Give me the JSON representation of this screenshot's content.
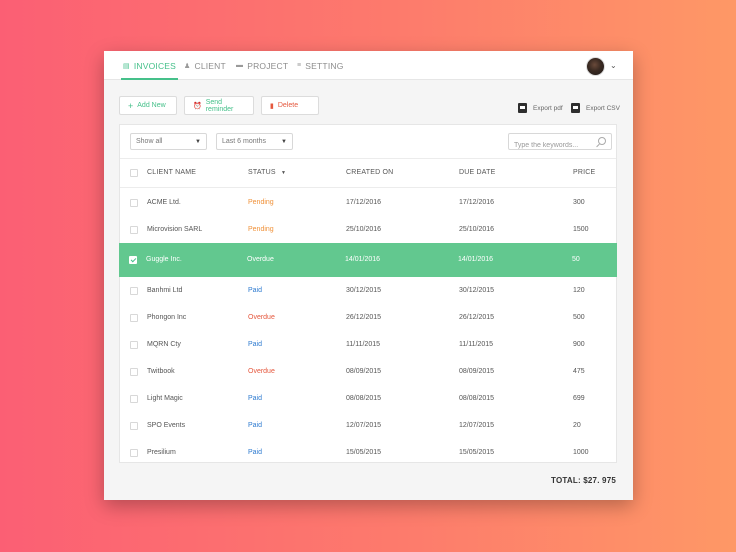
{
  "nav": {
    "tabs": [
      {
        "label": "INVOICES",
        "icon": "document-icon",
        "glyph": "▤"
      },
      {
        "label": "CLIENT",
        "icon": "user-icon",
        "glyph": "♟"
      },
      {
        "label": "PROJECT",
        "icon": "folder-icon",
        "glyph": "▬"
      },
      {
        "label": "SETTING",
        "icon": "sliders-icon",
        "glyph": "≡"
      }
    ],
    "active_tab": "INVOICES",
    "avatar_chevron": "⌄"
  },
  "toolbar": {
    "add_label": "Add New",
    "add_glyph": "+",
    "remind_label": "Send reminder",
    "remind_glyph": "⏰",
    "delete_label": "Delete",
    "delete_glyph": "▮",
    "export_pdf": "Export pdf",
    "export_csv": "Export CSV"
  },
  "filters": {
    "show": "Show all",
    "period": "Last 6 months",
    "caret": "▼",
    "search_placeholder": "Type the keywords..."
  },
  "table": {
    "headers": {
      "client": "CLIENT NAME",
      "status": "STATUS",
      "status_sort": "▼",
      "created": "CREATED ON",
      "due": "DUE DATE",
      "price": "PRICE"
    },
    "rows": [
      {
        "client": "ACME Ltd.",
        "status": "Pending",
        "created": "17/12/2016",
        "due": "17/12/2016",
        "price": "300"
      },
      {
        "client": "Microvision SARL",
        "status": "Pending",
        "created": "25/10/2016",
        "due": "25/10/2016",
        "price": "1500"
      },
      {
        "client": "Guggle Inc.",
        "status": "Overdue",
        "created": "14/01/2016",
        "due": "14/01/2016",
        "price": "50"
      },
      {
        "client": "Banhmi Ltd",
        "status": "Paid",
        "created": "30/12/2015",
        "due": "30/12/2015",
        "price": "120"
      },
      {
        "client": "Phongon Inc",
        "status": "Overdue",
        "created": "26/12/2015",
        "due": "26/12/2015",
        "price": "500"
      },
      {
        "client": "MQRN Cty",
        "status": "Paid",
        "created": "11/11/2015",
        "due": "11/11/2015",
        "price": "900"
      },
      {
        "client": "Twitbook",
        "status": "Overdue",
        "created": "08/09/2015",
        "due": "08/09/2015",
        "price": "475"
      },
      {
        "client": "Light Magic",
        "status": "Paid",
        "created": "08/08/2015",
        "due": "08/08/2015",
        "price": "699"
      },
      {
        "client": "SPO Events",
        "status": "Paid",
        "created": "12/07/2015",
        "due": "12/07/2015",
        "price": "20"
      },
      {
        "client": "Presilium",
        "status": "Paid",
        "created": "15/05/2015",
        "due": "15/05/2015",
        "price": "1000"
      }
    ],
    "selected_row": "Guggle Inc."
  },
  "footer": {
    "total": "TOTAL: $27. 975"
  },
  "colors": {
    "accent": "#45c08a",
    "selected_row": "#62c88f",
    "pending": "#f0923a",
    "overdue": "#e5583e",
    "paid": "#2e7bd0"
  }
}
